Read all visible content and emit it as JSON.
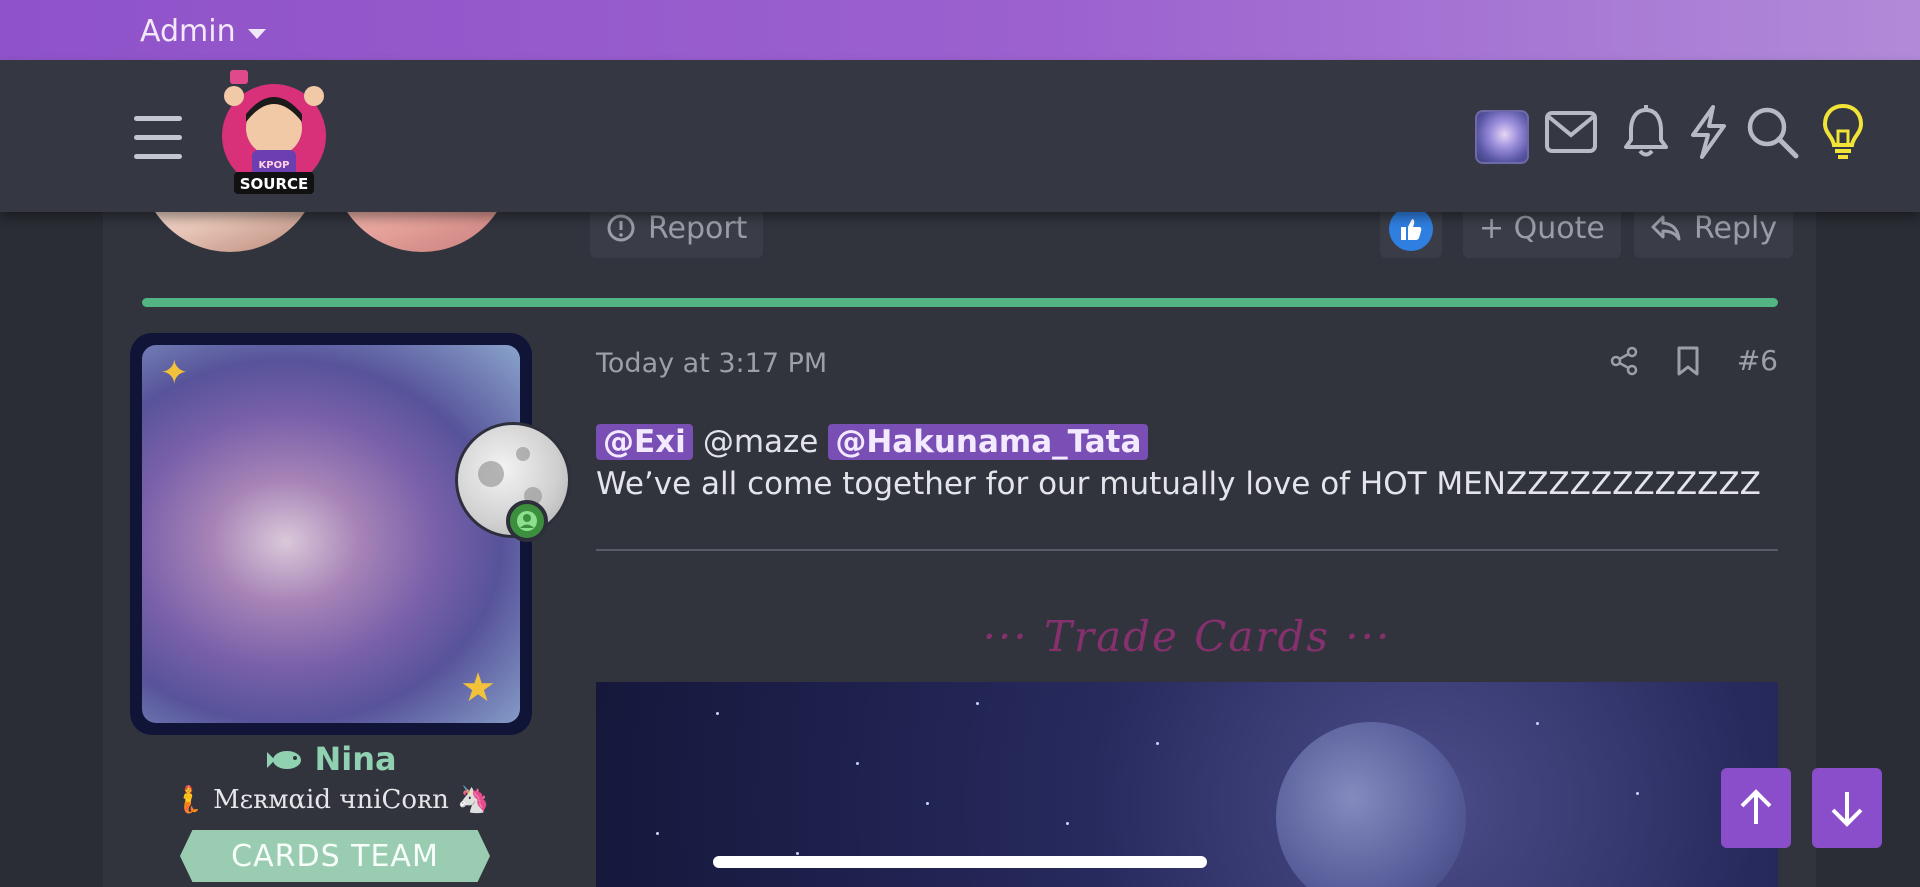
{
  "admin_bar": {
    "label": "Admin"
  },
  "header": {
    "logo_text_top": "KPOP",
    "logo_text_bottom": "SOURCE",
    "icons": [
      "menu-icon",
      "avatar",
      "mail-icon",
      "bell-icon",
      "bolt-icon",
      "search-icon",
      "lightbulb-icon"
    ],
    "lightbulb_color": "#f2e337"
  },
  "previous_post": {
    "report_label": "Report",
    "quote_label": "+ Quote",
    "reply_label": "Reply"
  },
  "post": {
    "timestamp": "Today at 3:17 PM",
    "post_number": "#6",
    "mentions": [
      "@Exi",
      "@maze",
      "@Hakunama_Tata"
    ],
    "message": "We’ve all come together for our mutually love of HOT MENZZZZZZZZZZZZ",
    "trade_title": "··· Trade Cards ···"
  },
  "user": {
    "name": "Nina",
    "title": "Mɛʀмαid чniCoʀn",
    "banner": "CARDS TEAM",
    "name_color": "#8fd1b1"
  },
  "colors": {
    "accent_purple": "#8a4ecb",
    "divider_green": "#52b383",
    "mention_bg": "#7a4fb5"
  }
}
